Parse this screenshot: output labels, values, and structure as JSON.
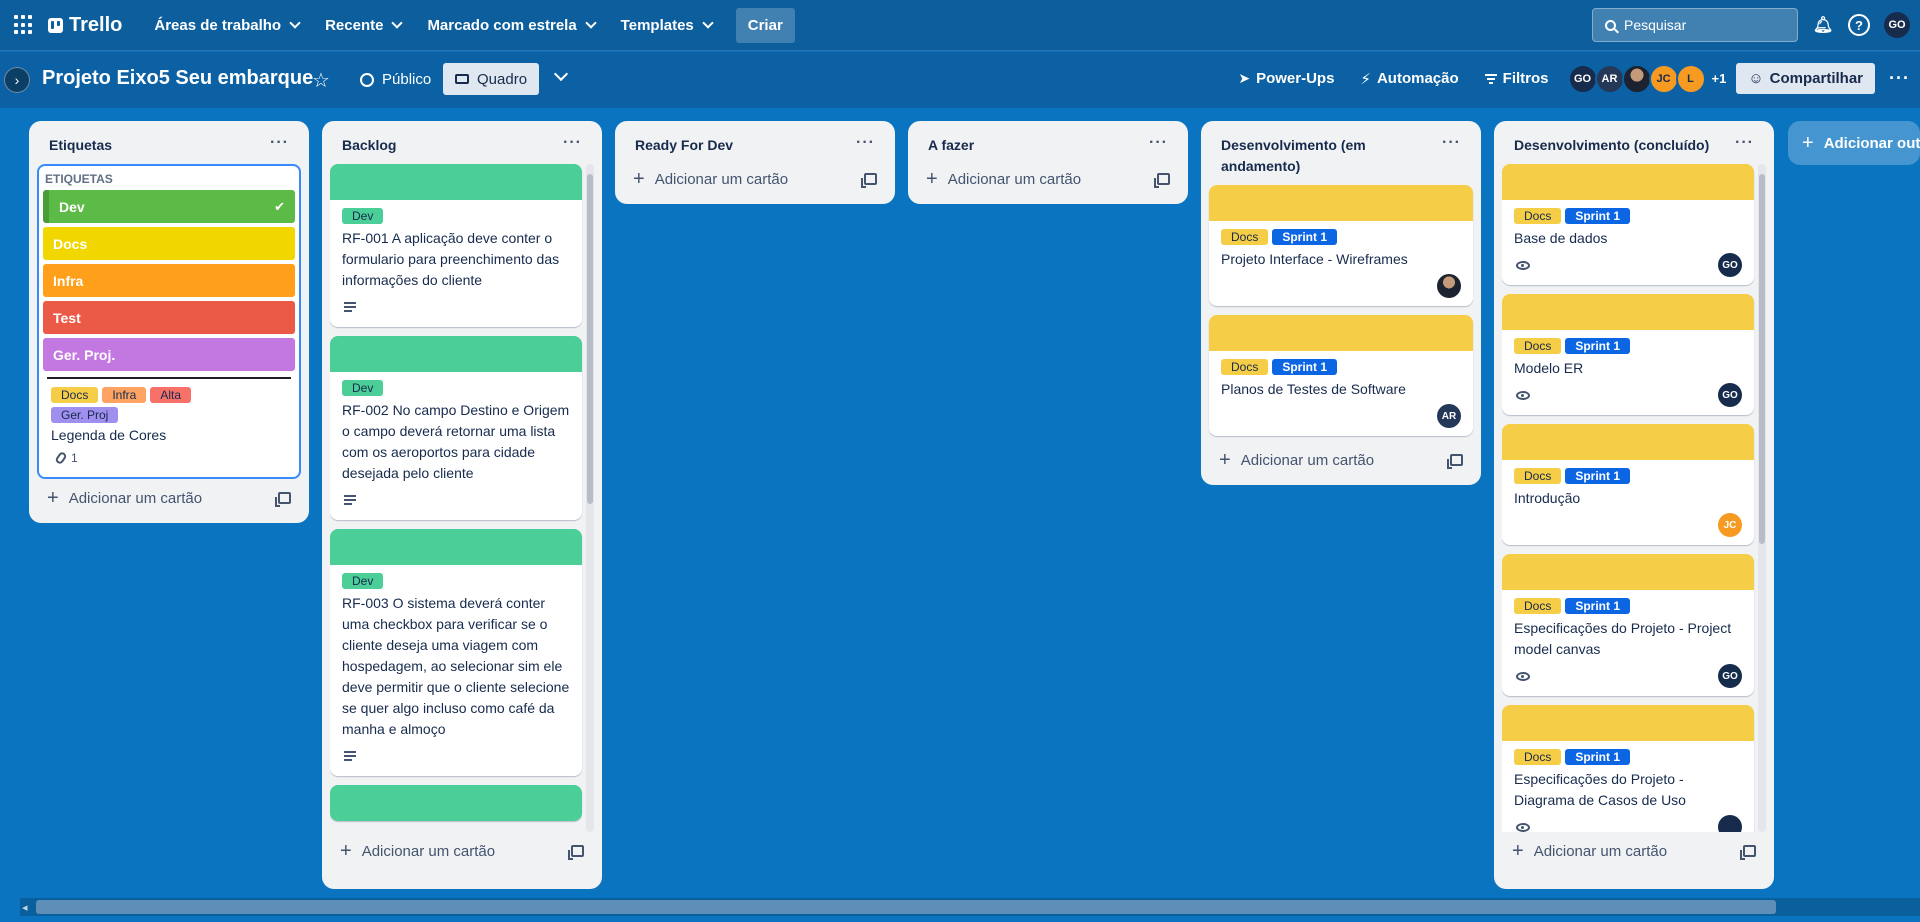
{
  "header": {
    "brand": "Trello",
    "nav": [
      "Áreas de trabalho",
      "Recente",
      "Marcado com estrela",
      "Templates"
    ],
    "create": "Criar",
    "search_placeholder": "Pesquisar",
    "user_initials": "GO"
  },
  "board": {
    "title": "Projeto Eixo5 Seu embarque",
    "visibility": "Público",
    "view": "Quadro",
    "powerups": "Power-Ups",
    "automation": "Automação",
    "filters": "Filtros",
    "members": [
      "GO",
      "AR",
      "JC",
      "L"
    ],
    "more_members": "+1",
    "share": "Compartilhar",
    "add_list": "Adicionar outra lista"
  },
  "common": {
    "add_card": "Adicionar um cartão"
  },
  "lists": {
    "etiquetas": {
      "title": "Etiquetas",
      "legend_heading": "ETIQUETAS",
      "rows": [
        "Dev",
        "Docs",
        "Infra",
        "Test",
        "Ger. Proj."
      ],
      "labels": [
        "Docs",
        "Infra",
        "Alta",
        "Ger. Proj"
      ],
      "card_title": "Legenda de Cores",
      "attachments": "1"
    },
    "backlog": {
      "title": "Backlog",
      "cards": [
        {
          "label": "Dev",
          "title": "RF-001 A aplicação deve conter o formulario para preenchimento das informações do cliente"
        },
        {
          "label": "Dev",
          "title": "RF-002 No campo Destino e Origem o campo deverá retornar uma lista com os aeroportos para cidade desejada pelo cliente"
        },
        {
          "label": "Dev",
          "title": "RF-003 O sistema deverá conter uma checkbox para verificar se o cliente deseja uma viagem com hospedagem, ao selecionar sim ele deve permitir que o cliente selecione se quer algo incluso como café da manha e almoço"
        }
      ]
    },
    "ready": {
      "title": "Ready For Dev"
    },
    "todo": {
      "title": "A fazer"
    },
    "dev_progress": {
      "title": "Desenvolvimento (em andamento)",
      "cards": [
        {
          "labels": [
            "Docs",
            "Sprint 1"
          ],
          "title": "Projeto Interface - Wireframes",
          "member": ""
        },
        {
          "labels": [
            "Docs",
            "Sprint 1"
          ],
          "title": "Planos de Testes de Software",
          "member": "AR"
        }
      ]
    },
    "dev_done": {
      "title": "Desenvolvimento (concluído)",
      "cards": [
        {
          "labels": [
            "Docs",
            "Sprint 1"
          ],
          "title": "Base de dados",
          "member": "GO"
        },
        {
          "labels": [
            "Docs",
            "Sprint 1"
          ],
          "title": "Modelo ER",
          "member": "GO"
        },
        {
          "labels": [
            "Docs",
            "Sprint 1"
          ],
          "title": "Introdução",
          "member": "JC"
        },
        {
          "labels": [
            "Docs",
            "Sprint 1"
          ],
          "title": "Especificações do Projeto - Project model canvas",
          "member": "GO"
        },
        {
          "labels": [
            "Docs",
            "Sprint 1"
          ],
          "title": "Especificações do Projeto - Diagrama de Casos de Uso",
          "member": ""
        }
      ]
    }
  },
  "colors": {
    "board_bg": "#0a74c1",
    "dev_green": "#4bce97",
    "docs_yellow": "#f5cd47",
    "sprint_blue": "#0c66e4"
  }
}
